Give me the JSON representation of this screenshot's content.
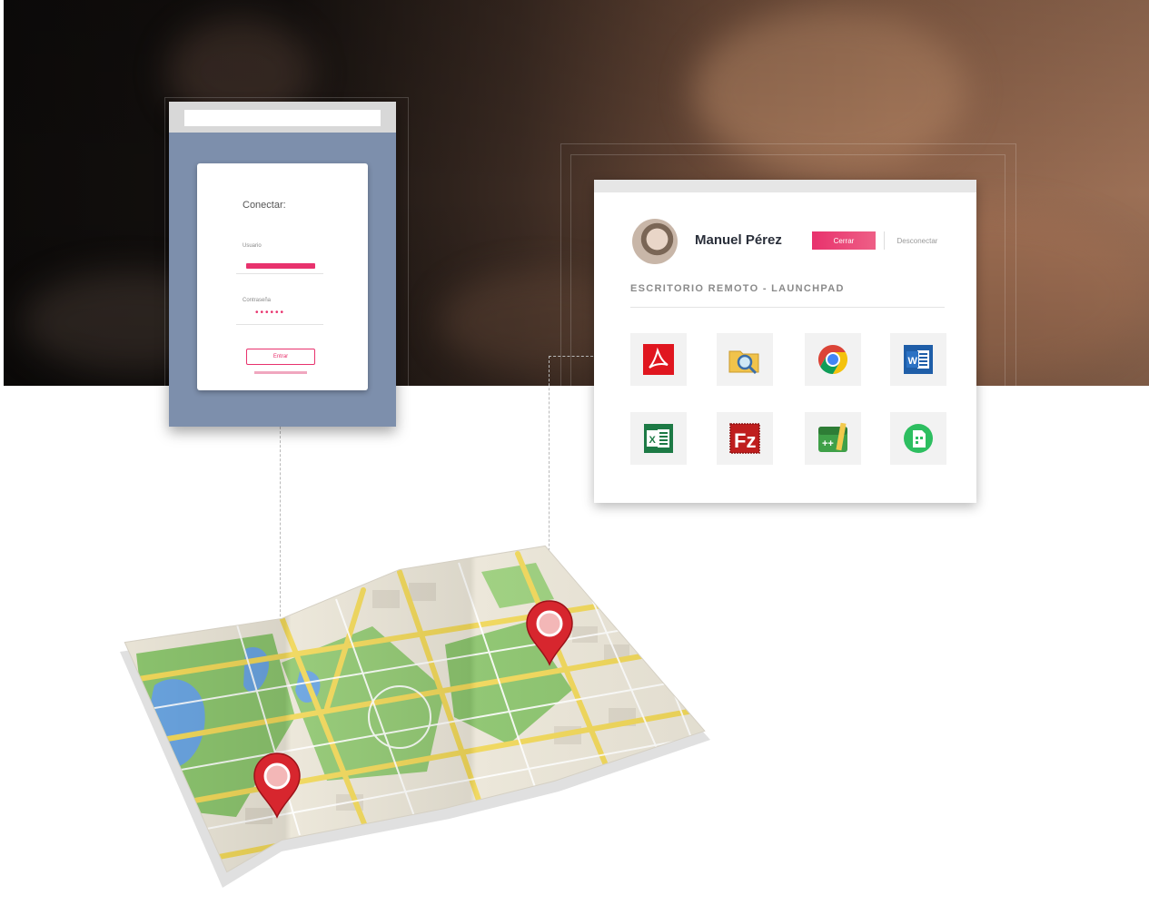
{
  "login": {
    "title": "Conectar:",
    "user_label": "Usuario",
    "password_label": "Contraseña",
    "password_mask": "••••••",
    "enter_label": "Entrar"
  },
  "launchpad": {
    "user_name": "Manuel Pérez",
    "close_label": "Cerrar",
    "disconnect_label": "Desconectar",
    "section_title": "ESCRITORIO REMOTO - LAUNCHPAD",
    "apps": [
      {
        "icon": "pdf-icon"
      },
      {
        "icon": "folder-search-icon"
      },
      {
        "icon": "chrome-icon"
      },
      {
        "icon": "word-icon"
      },
      {
        "icon": "excel-icon"
      },
      {
        "icon": "filezilla-icon"
      },
      {
        "icon": "calculator-app-icon"
      },
      {
        "icon": "evernote-icon"
      }
    ]
  },
  "map": {
    "icon": "folded-map-icon",
    "pins": [
      "map-pin-icon",
      "map-pin-icon"
    ]
  },
  "colors": {
    "accent": "#e8326d",
    "phone": "#7d8fac",
    "map_park": "#8cc46e",
    "map_road": "#f0d75a",
    "pin": "#d7262e"
  }
}
